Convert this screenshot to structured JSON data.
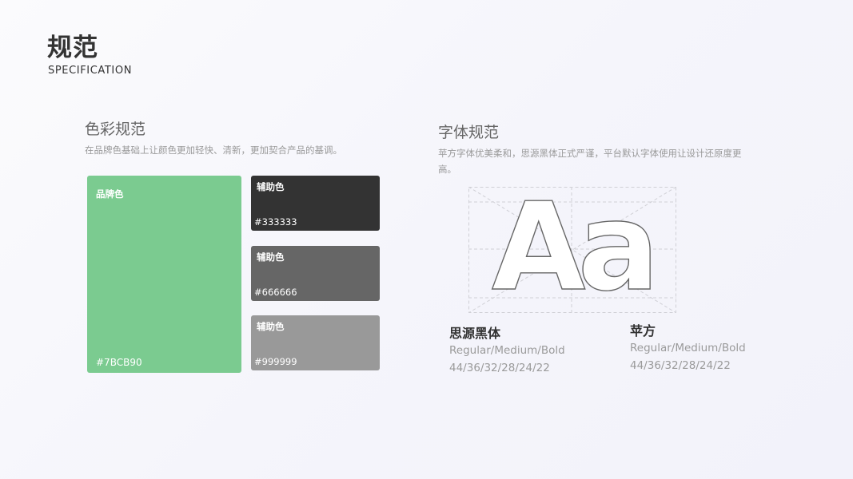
{
  "header": {
    "title": "规范",
    "subtitle": "SPECIFICATION"
  },
  "color_section": {
    "title": "色彩规范",
    "description": "在品牌色基础上让颜色更加轻快、清新，更加契合产品的基调。",
    "brand": {
      "label": "品牌色",
      "hex": "#7BCB90",
      "color": "#7BCB90"
    },
    "aux": [
      {
        "label": "辅助色",
        "hex": "#333333",
        "color": "#333333"
      },
      {
        "label": "辅助色",
        "hex": "#666666",
        "color": "#666666"
      },
      {
        "label": "辅助色",
        "hex": "#999999",
        "color": "#999999"
      }
    ]
  },
  "font_section": {
    "title": "字体规范",
    "description": "苹方字体优美柔和，思源黑体正式严谨，平台默认字体使用让设计还原度更高。",
    "glyph_sample": "Aa",
    "fonts": [
      {
        "name": "思源黑体",
        "weights": "Regular/Medium/Bold",
        "sizes": "44/36/32/28/24/22"
      },
      {
        "name": "苹方",
        "weights": "Regular/Medium/Bold",
        "sizes": "44/36/32/28/24/22"
      }
    ]
  }
}
